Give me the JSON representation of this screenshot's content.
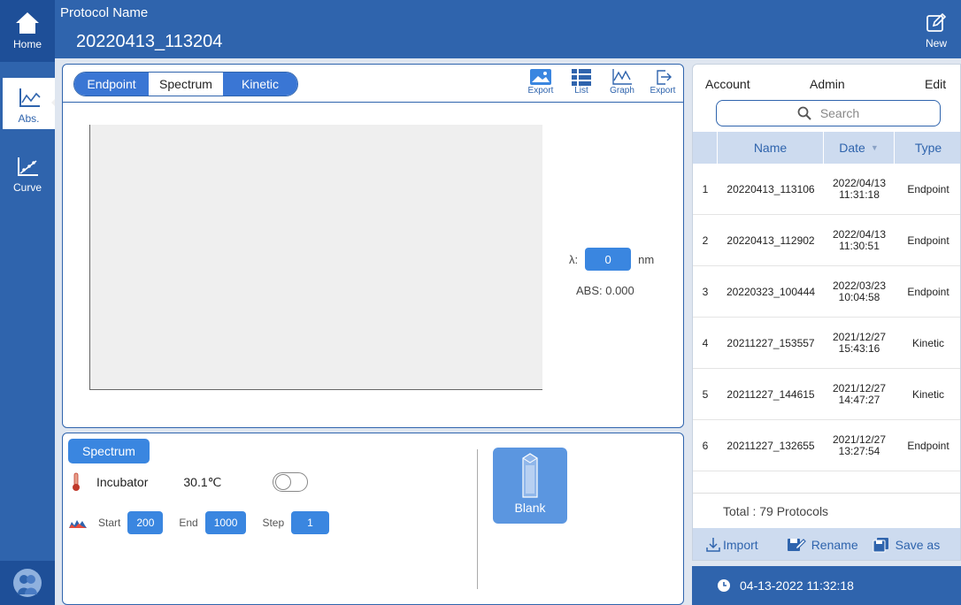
{
  "rail": {
    "home_label": "Home",
    "abs_label": "Abs.",
    "curve_label": "Curve"
  },
  "topbar": {
    "protocol_label": "Protocol Name",
    "protocol_name": "20220413_113204",
    "new_label": "New"
  },
  "graph": {
    "modes": [
      "Endpoint",
      "Spectrum",
      "Kinetic"
    ],
    "tools": [
      "Export",
      "List",
      "Graph",
      "Export"
    ],
    "lambda_label": "λ:",
    "lambda_value": "0",
    "lambda_unit": "nm",
    "abs_readout": "ABS: 0.000"
  },
  "settings": {
    "mode_tag": "Spectrum",
    "incubator_label": "Incubator",
    "incubator_temp": "30.1℃",
    "start_label": "Start",
    "start_value": "200",
    "end_label": "End",
    "end_value": "1000",
    "step_label": "Step",
    "step_value": "1",
    "blank_label": "Blank"
  },
  "list": {
    "account_label": "Account",
    "admin_label": "Admin",
    "edit_label": "Edit",
    "search_placeholder": "Search",
    "columns": {
      "name": "Name",
      "date": "Date",
      "type": "Type"
    },
    "rows": [
      {
        "num": "1",
        "name": "20220413_113106",
        "date": "2022/04/13",
        "time": "11:31:18",
        "type": "Endpoint"
      },
      {
        "num": "2",
        "name": "20220413_112902",
        "date": "2022/04/13",
        "time": "11:30:51",
        "type": "Endpoint"
      },
      {
        "num": "3",
        "name": "20220323_100444",
        "date": "2022/03/23",
        "time": "10:04:58",
        "type": "Endpoint"
      },
      {
        "num": "4",
        "name": "20211227_153557",
        "date": "2021/12/27",
        "time": "15:43:16",
        "type": "Kinetic"
      },
      {
        "num": "5",
        "name": "20211227_144615",
        "date": "2021/12/27",
        "time": "14:47:27",
        "type": "Kinetic"
      },
      {
        "num": "6",
        "name": "20211227_132655",
        "date": "2021/12/27",
        "time": "13:27:54",
        "type": "Endpoint"
      }
    ],
    "total": "Total : 79 Protocols",
    "import_label": "Import",
    "rename_label": "Rename",
    "saveas_label": "Save as"
  },
  "status": {
    "datetime": "04-13-2022 11:32:18"
  },
  "colors": {
    "primary": "#2f64ad",
    "accent": "#3a86e0",
    "panel_bg": "#dfe6f0"
  }
}
